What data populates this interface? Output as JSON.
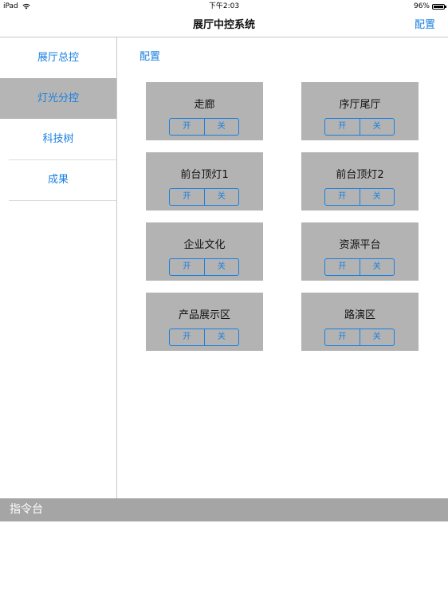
{
  "status": {
    "device": "iPad",
    "time": "下午2:03",
    "battery": "96%"
  },
  "nav": {
    "title": "展厅中控系统",
    "config": "配置"
  },
  "sidebar": {
    "items": [
      {
        "label": "展厅总控"
      },
      {
        "label": "灯光分控",
        "active": true
      },
      {
        "label": "科技树"
      },
      {
        "label": "成果"
      }
    ]
  },
  "main": {
    "config_link": "配置",
    "on_label": "开",
    "off_label": "关",
    "lights": [
      {
        "name": "走廊"
      },
      {
        "name": "序厅尾厅"
      },
      {
        "name": "前台顶灯1"
      },
      {
        "name": "前台顶灯2"
      },
      {
        "name": "企业文化"
      },
      {
        "name": "资源平台"
      },
      {
        "name": "产品展示区"
      },
      {
        "name": "路演区"
      }
    ]
  },
  "command": {
    "title": "指令台"
  },
  "colors": {
    "accent": "#1a7fe0",
    "card": "#b3b3b3",
    "active_item": "#b5b5b5",
    "command_bar": "#a5a5a5"
  },
  "icons": [
    "wifi-icon",
    "battery-icon"
  ]
}
